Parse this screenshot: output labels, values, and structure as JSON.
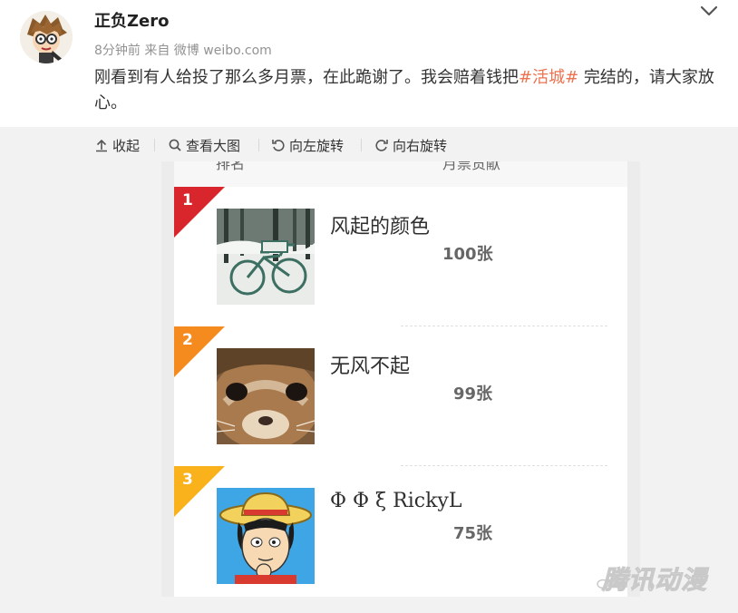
{
  "post": {
    "username": "正负Zero",
    "meta": "8分钟前 来自 微博 weibo.com",
    "text_before": "刚看到有人给投了那么多月票，在此跪谢了。我会赔着钱把",
    "hashtag": "#活城#",
    "text_after": " 完结的，请大家放心。"
  },
  "toolbar": {
    "collapse": "收起",
    "view_large": "查看大图",
    "rotate_left": "向左旋转",
    "rotate_right": "向右旋转"
  },
  "ranking": {
    "header_left": "排名",
    "header_right": "月票贡献",
    "rows": [
      {
        "rank": "1",
        "name": "风起的颜色",
        "votes": "100张",
        "flag_color": "#d9262c",
        "picture": "bicycle-in-snow"
      },
      {
        "rank": "2",
        "name": "无风不起",
        "votes": "99张",
        "flag_color": "#f58a1f",
        "picture": "squirrel-face"
      },
      {
        "rank": "3",
        "name": "Φ Φ ξ RickyL",
        "votes": "75张",
        "flag_color": "#f9b21c",
        "picture": "straw-hat-cartoon"
      }
    ]
  },
  "watermark": "腾讯动漫",
  "colors": {
    "hashtag": "#eb7350",
    "media_bg": "#f2f2f2",
    "meta": "#939393"
  }
}
